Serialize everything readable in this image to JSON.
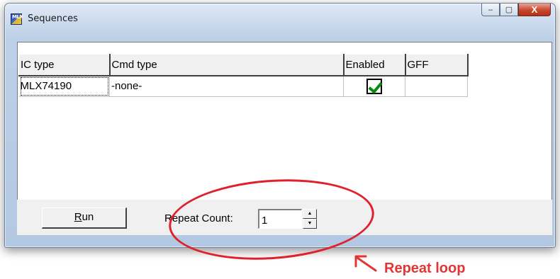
{
  "window": {
    "title": "Sequences",
    "app_icon_text": "MLX",
    "caption": {
      "minimize": "–",
      "maximize": "▢",
      "close": "X"
    }
  },
  "grid": {
    "columns": [
      "IC type",
      "Cmd type",
      "Enabled",
      "GFF"
    ],
    "rows": [
      {
        "ic_type": "MLX74190",
        "cmd_type": "-none-",
        "enabled": true,
        "gff": ""
      }
    ]
  },
  "controls": {
    "run_label_underlined": "R",
    "run_label_rest": "un",
    "repeat_label": "Repeat Count:",
    "repeat_value": "1",
    "spin_up": "▲",
    "spin_down": "▼"
  },
  "annotation": {
    "text": "Repeat loop",
    "color": "#e23636"
  }
}
